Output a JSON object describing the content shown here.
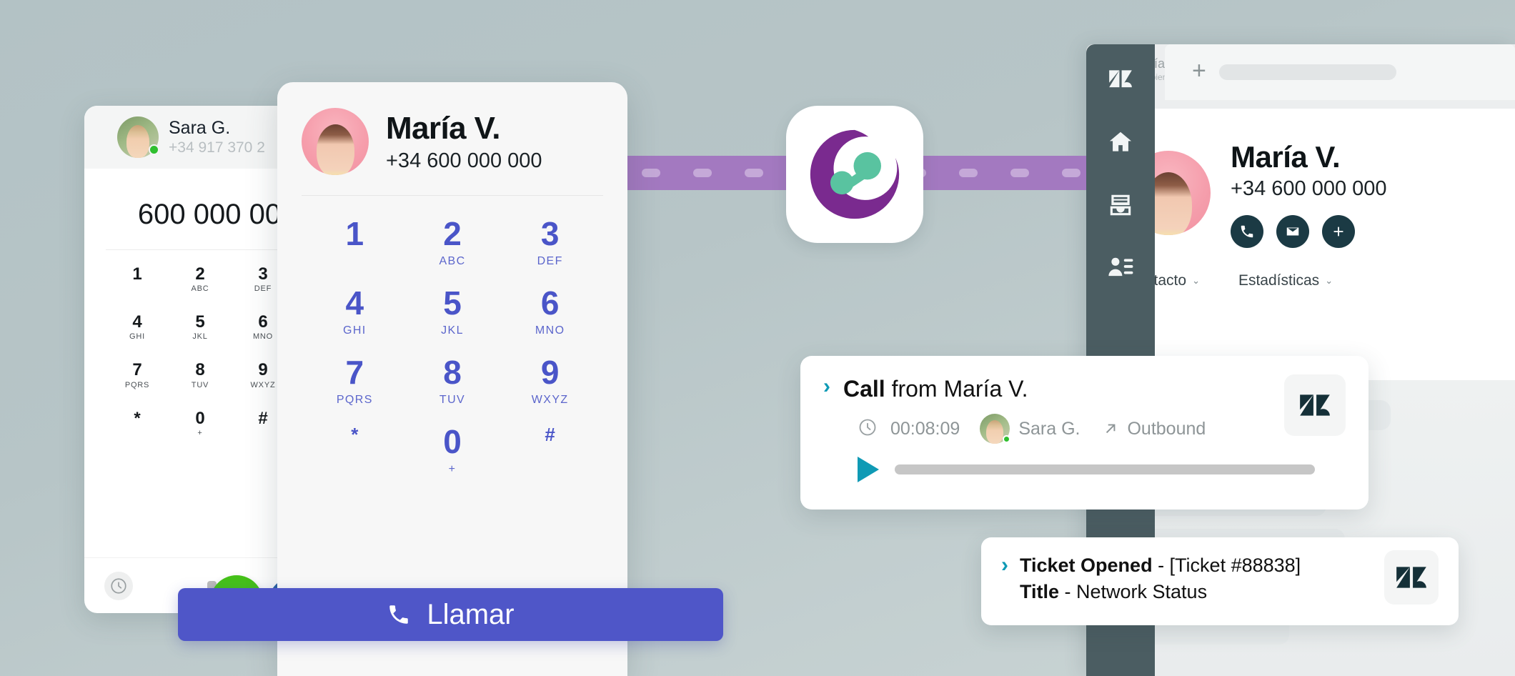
{
  "background": {
    "color_top": "#b3c2c5",
    "color_bottom": "#cbd5d5"
  },
  "brand": {
    "purple": "#7a2a8f",
    "green": "#59c3a0",
    "connector": "#a379c0",
    "accent_blue": "#4f56c8",
    "zendesk_dark": "#153038"
  },
  "app_logo": {
    "name": "connect-app-logo"
  },
  "left_phone_card": {
    "agent": {
      "name": "Sara G.",
      "phone": "+34 917 370 2",
      "status": "online"
    },
    "dialed_number": "600 000 00",
    "keys": [
      {
        "digit": "1",
        "letters": ""
      },
      {
        "digit": "2",
        "letters": "ABC"
      },
      {
        "digit": "3",
        "letters": "DEF"
      },
      {
        "digit": "4",
        "letters": "GHI"
      },
      {
        "digit": "5",
        "letters": "JKL"
      },
      {
        "digit": "6",
        "letters": "MNO"
      },
      {
        "digit": "7",
        "letters": "PQRS"
      },
      {
        "digit": "8",
        "letters": "TUV"
      },
      {
        "digit": "9",
        "letters": "WXYZ"
      },
      {
        "digit": "*",
        "letters": ""
      },
      {
        "digit": "0",
        "letters": "+"
      },
      {
        "digit": "#",
        "letters": ""
      }
    ],
    "call_button": "call",
    "footer": {
      "history_icon": "clock-icon",
      "pager_dots": 2
    }
  },
  "dialpad_card": {
    "contact": {
      "name": "María V.",
      "phone": "+34 600 000 000"
    },
    "keys": [
      {
        "digit": "1",
        "letters": ""
      },
      {
        "digit": "2",
        "letters": "ABC"
      },
      {
        "digit": "3",
        "letters": "DEF"
      },
      {
        "digit": "4",
        "letters": "GHI"
      },
      {
        "digit": "5",
        "letters": "JKL"
      },
      {
        "digit": "6",
        "letters": "MNO"
      },
      {
        "digit": "7",
        "letters": "PQRS"
      },
      {
        "digit": "8",
        "letters": "TUV"
      },
      {
        "digit": "9",
        "letters": "WXYZ"
      },
      {
        "digit": "*",
        "letters": ""
      },
      {
        "digit": "0",
        "letters": "+"
      },
      {
        "digit": "#",
        "letters": ""
      }
    ]
  },
  "call_button": {
    "label": "Llamar",
    "icon": "phone-icon"
  },
  "zendesk": {
    "sidebar": [
      {
        "name": "zendesk-logo",
        "icon": "zendesk-logo-icon"
      },
      {
        "name": "home",
        "icon": "home-icon"
      },
      {
        "name": "views",
        "icon": "views-icon"
      },
      {
        "name": "customers",
        "icon": "customers-icon"
      }
    ],
    "tab": {
      "user_name": "María V",
      "status": "Escribiendo...",
      "add_icon": "plus-icon"
    },
    "contact": {
      "name": "María V.",
      "phone": "+34 600 000 000",
      "actions": [
        {
          "name": "call-action",
          "icon": "phone-icon"
        },
        {
          "name": "email-action",
          "icon": "envelope-icon"
        },
        {
          "name": "add-action",
          "icon": "plus-icon"
        }
      ]
    },
    "tabs": [
      {
        "label": "Contacto",
        "chevron": "⌄"
      },
      {
        "label": "Estadísticas",
        "chevron": "⌄"
      }
    ]
  },
  "call_notification": {
    "chevron": "›",
    "title_bold": "Call",
    "title_rest": " from María V.",
    "duration": "00:08:09",
    "agent_name": "Sara G.",
    "direction": "Outbound",
    "direction_icon": "arrow-up-right-icon",
    "clock_icon": "clock-icon",
    "play_icon": "play-icon",
    "source_icon": "zendesk-logo-icon"
  },
  "ticket_notification": {
    "chevron": "›",
    "line1_bold": "Ticket Opened",
    "line1_rest": " - [Ticket #88838]",
    "line2_bold": "Title",
    "line2_rest": " - Network Status",
    "source_icon": "zendesk-logo-icon"
  }
}
